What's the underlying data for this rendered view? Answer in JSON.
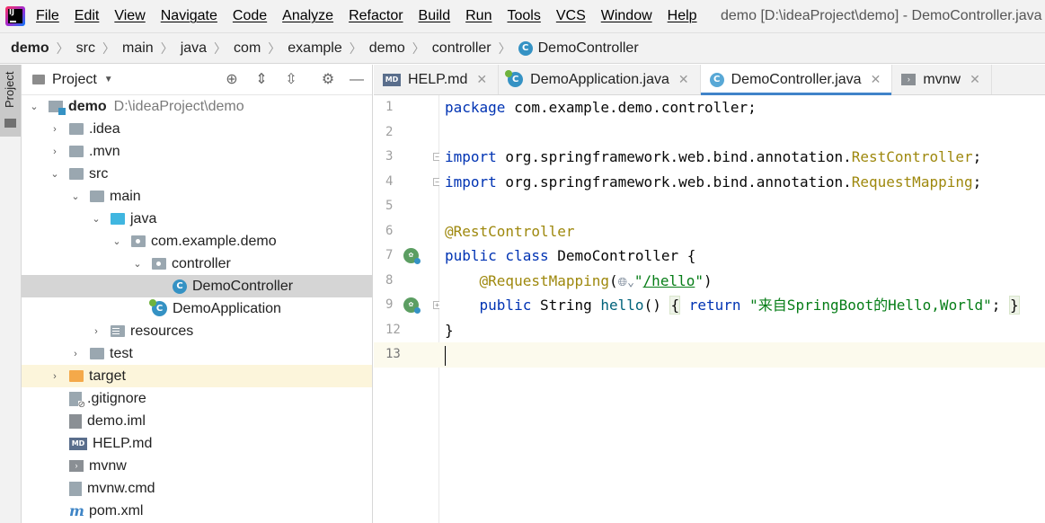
{
  "menubar": {
    "items": [
      "File",
      "Edit",
      "View",
      "Navigate",
      "Code",
      "Analyze",
      "Refactor",
      "Build",
      "Run",
      "Tools",
      "VCS",
      "Window",
      "Help"
    ],
    "window_title": "demo [D:\\ideaProject\\demo] - DemoController.java"
  },
  "breadcrumb": [
    "demo",
    "src",
    "main",
    "java",
    "com",
    "example",
    "demo",
    "controller",
    "DemoController"
  ],
  "tool_strip": {
    "project_tab": "Project"
  },
  "project_panel": {
    "title": "Project",
    "tree": [
      {
        "label": "demo",
        "path": "D:\\ideaProject\\demo",
        "expanded": true
      },
      {
        "label": ".idea"
      },
      {
        "label": ".mvn"
      },
      {
        "label": "src"
      },
      {
        "label": "main"
      },
      {
        "label": "java"
      },
      {
        "label": "com.example.demo"
      },
      {
        "label": "controller"
      },
      {
        "label": "DemoController",
        "selected": true
      },
      {
        "label": "DemoApplication"
      },
      {
        "label": "resources"
      },
      {
        "label": "test"
      },
      {
        "label": "target"
      },
      {
        "label": ".gitignore"
      },
      {
        "label": "demo.iml"
      },
      {
        "label": "HELP.md"
      },
      {
        "label": "mvnw"
      },
      {
        "label": "mvnw.cmd"
      },
      {
        "label": "pom.xml"
      }
    ]
  },
  "editor": {
    "tabs": [
      {
        "label": "HELP.md"
      },
      {
        "label": "DemoApplication.java"
      },
      {
        "label": "DemoController.java",
        "active": true
      },
      {
        "label": "mvnw"
      }
    ],
    "line_numbers": [
      "1",
      "2",
      "3",
      "4",
      "5",
      "6",
      "7",
      "8",
      "9",
      "12",
      "13"
    ],
    "code": {
      "l1_kw": "package",
      "l1_rest": " com.example.demo.controller;",
      "l3_kw": "import",
      "l3_pkg": " org.springframework.web.bind.annotation.",
      "l3_cls": "RestController",
      "l3_end": ";",
      "l4_kw": "import",
      "l4_pkg": " org.springframework.web.bind.annotation.",
      "l4_cls": "RequestMapping",
      "l4_end": ";",
      "l6_ann": "@RestController",
      "l7_kw1": "public",
      "l7_kw2": " class",
      "l7_rest": " DemoController {",
      "l8_ann": "@RequestMapping",
      "l8_open": "(",
      "l8_str_q1": "\"",
      "l8_str": "/hello",
      "l8_str_q2": "\"",
      "l8_close": ")",
      "l9_kw": "public",
      "l9_type": " String ",
      "l9_fn": "hello",
      "l9_paren": "() ",
      "l9_brace_open": "{",
      "l9_kw2": " return ",
      "l9_str": "\"来自SpringBoot的Hello,World\"",
      "l9_semi": "; ",
      "l9_brace_close": "}",
      "l12": "}"
    }
  }
}
